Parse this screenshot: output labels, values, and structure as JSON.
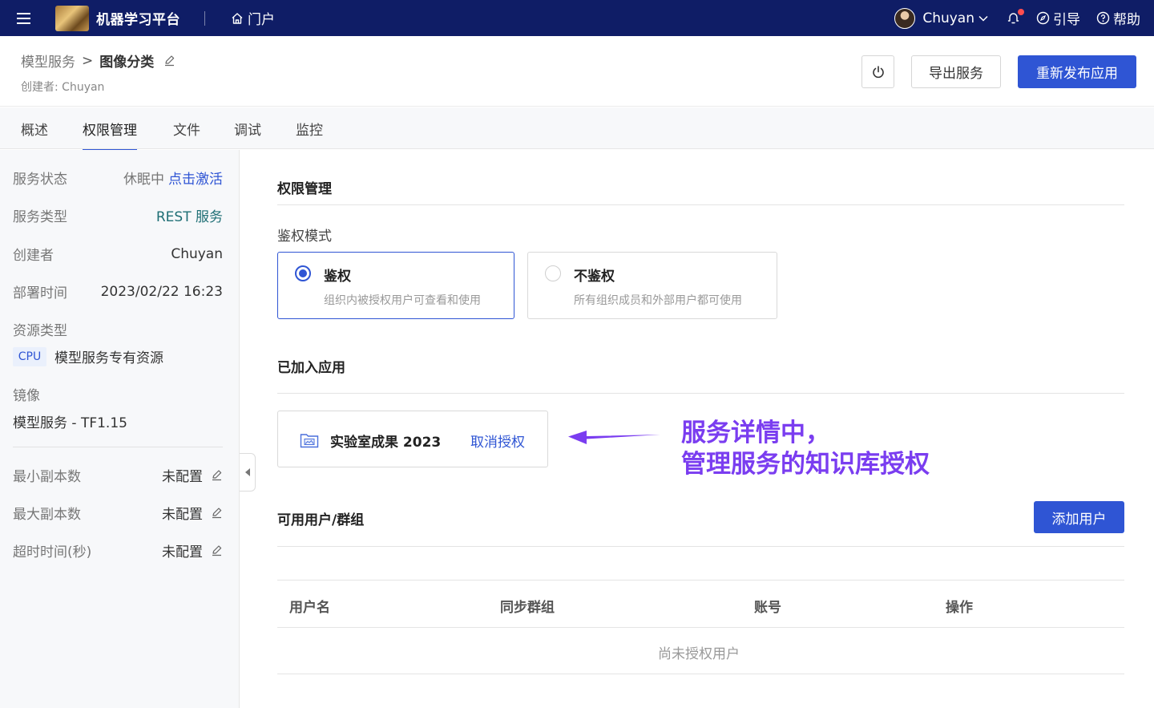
{
  "topbar": {
    "brand": "机器学习平台",
    "portal": "门户",
    "user": "Chuyan",
    "guide": "引导",
    "help": "帮助"
  },
  "header": {
    "breadcrumb_parent": "模型服务",
    "breadcrumb_sep": ">",
    "breadcrumb_current": "图像分类",
    "creator": "创建者: Chuyan",
    "export_label": "导出服务",
    "republish_label": "重新发布应用"
  },
  "tabs": [
    {
      "label": "概述"
    },
    {
      "label": "权限管理"
    },
    {
      "label": "文件"
    },
    {
      "label": "调试"
    },
    {
      "label": "监控"
    }
  ],
  "sidebar": {
    "status_label": "服务状态",
    "status_value": "休眠中",
    "activate_label": "点击激活",
    "type_label": "服务类型",
    "type_value": "REST 服务",
    "creator_label": "创建者",
    "creator_value": "Chuyan",
    "deploy_label": "部署时间",
    "deploy_value": "2023/02/22 16:23",
    "resource_label": "资源类型",
    "resource_tag": "CPU",
    "resource_value": "模型服务专有资源",
    "mirror_label": "镜像",
    "mirror_value": "模型服务 - TF1.15",
    "min_label": "最小副本数",
    "min_value": "未配置",
    "max_label": "最大副本数",
    "max_value": "未配置",
    "timeout_label": "超时时间(秒)",
    "timeout_value": "未配置"
  },
  "main": {
    "title": "权限管理",
    "auth_mode_label": "鉴权模式",
    "options": [
      {
        "title": "鉴权",
        "desc": "组织内被授权用户可查看和使用",
        "selected": true
      },
      {
        "title": "不鉴权",
        "desc": "所有组织成员和外部用户都可使用",
        "selected": false
      }
    ],
    "joined_apps_title": "已加入应用",
    "app_name": "实验室成果 2023",
    "revoke_label": "取消授权",
    "annotation_line1": "服务详情中，",
    "annotation_line2": "管理服务的知识库授权",
    "users_title": "可用用户/群组",
    "add_user_label": "添加用户",
    "table_headers": [
      "用户名",
      "同步群组",
      "账号",
      "操作"
    ],
    "empty_text": "尚未授权用户"
  },
  "colors": {
    "topbar": "#0f1d66",
    "primary": "#2f55d4",
    "annotation": "#7a3df0"
  }
}
